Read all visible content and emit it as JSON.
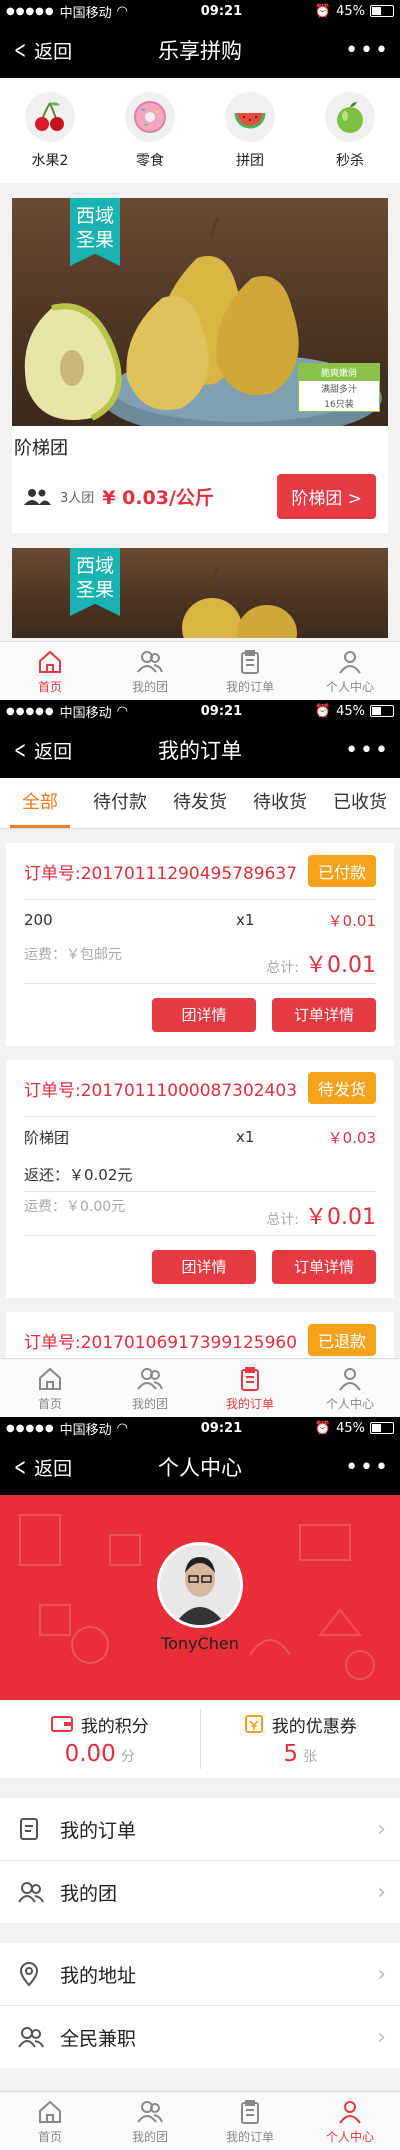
{
  "status": {
    "carrier": "中国移动",
    "time": "09:21",
    "battery": "45%"
  },
  "screen1": {
    "back_label": "返回",
    "title": "乐享拼购",
    "more": "•••",
    "categories": [
      {
        "label": "水果2",
        "icon": "cherry-icon"
      },
      {
        "label": "零食",
        "icon": "donut-icon"
      },
      {
        "label": "拼团",
        "icon": "watermelon-icon"
      },
      {
        "label": "秒杀",
        "icon": "apple-icon"
      }
    ],
    "product": {
      "ribbon_line1": "西域",
      "ribbon_line2": "圣果",
      "tag1": "脆爽嫩俏",
      "tag2": "满甜多汁",
      "tag3": "16只装",
      "title": "阶梯团",
      "people": "3人团",
      "price": "¥ 0.03/公斤",
      "button": "阶梯团 >"
    },
    "product2": {
      "ribbon_line1": "西域",
      "ribbon_line2": "圣果"
    }
  },
  "tabbar": {
    "home": "首页",
    "my_group": "我的团",
    "my_orders": "我的订单",
    "profile": "个人中心"
  },
  "screen2": {
    "back_label": "返回",
    "title": "我的订单",
    "tabs": [
      "全部",
      "待付款",
      "待发货",
      "待收货",
      "已收货"
    ],
    "orders": [
      {
        "order_no": "订单号:20170111290495789637",
        "status": "已付款",
        "item": "200",
        "qty": "x1",
        "amount": "￥0.01",
        "ship_label": "运费：￥包邮元",
        "total_label": "总计:",
        "total": "￥0.01",
        "btn_detail": "团详情",
        "btn_order": "订单详情"
      },
      {
        "order_no": "订单号:20170111000087302403",
        "status": "待发货",
        "item": "阶梯团",
        "qty": "x1",
        "amount": "￥0.03",
        "refund": "返还：￥0.02元",
        "ship_label": "运费：￥0.00元",
        "total_label": "总计:",
        "total": "￥0.01",
        "btn_detail": "团详情",
        "btn_order": "订单详情"
      },
      {
        "order_no": "订单号:20170106917399125960",
        "status": "已退款"
      }
    ]
  },
  "screen3": {
    "back_label": "返回",
    "title": "个人中心",
    "username": "TonyChen",
    "points_label": "我的积分",
    "points_value": "0.00",
    "points_unit": "分",
    "coupons_label": "我的优惠券",
    "coupons_value": "5",
    "coupons_unit": "张",
    "menu1": [
      "我的订单",
      "我的团"
    ],
    "menu2": [
      "我的地址",
      "全民兼职"
    ]
  },
  "colors": {
    "accent": "#e83a42",
    "orange": "#f07b23",
    "badge": "#f6a21d",
    "teal": "#1ab3b3"
  }
}
